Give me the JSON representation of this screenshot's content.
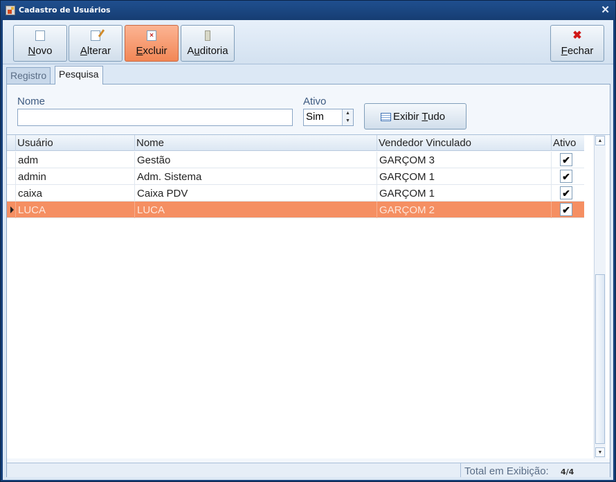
{
  "window": {
    "title": "Cadastro de Usuários"
  },
  "toolbar": {
    "novo": {
      "label": "Novo",
      "key": "N",
      "rest": "ovo"
    },
    "alterar": {
      "label": "Alterar",
      "key": "A",
      "rest": "lterar"
    },
    "excluir": {
      "label": "Excluir",
      "key": "E",
      "rest": "xcluir"
    },
    "auditoria": {
      "label": "Auditoria",
      "key": "u",
      "pre": "A",
      "rest": "ditoria"
    },
    "fechar": {
      "label": "Fechar",
      "key": "F",
      "rest": "echar"
    }
  },
  "tabs": [
    {
      "label": "Registro",
      "selected": false
    },
    {
      "label": "Pesquisa",
      "selected": true
    }
  ],
  "filters": {
    "nome_label": "Nome",
    "nome_value": "",
    "ativo_label": "Ativo",
    "ativo_value": "Sim",
    "exibir_pre": "Exibir ",
    "exibir_key": "T",
    "exibir_rest": "udo"
  },
  "grid": {
    "columns": [
      "Usuário",
      "Nome",
      "Vendedor Vinculado",
      "Ativo"
    ],
    "rows": [
      {
        "usuario": "adm",
        "nome": "Gestão",
        "vendedor": "GARÇOM 3",
        "ativo": true
      },
      {
        "usuario": "admin",
        "nome": "Adm. Sistema",
        "vendedor": "GARÇOM 1",
        "ativo": true
      },
      {
        "usuario": "caixa",
        "nome": "Caixa PDV",
        "vendedor": "GARÇOM 1",
        "ativo": true
      },
      {
        "usuario": "LUCA",
        "nome": "LUCA",
        "vendedor": "GARÇOM 2",
        "ativo": true
      }
    ]
  },
  "status": {
    "label": "Total em Exibição:",
    "value": "4/4"
  },
  "colors": {
    "selected_row": "#f58f62",
    "window_frame": "#16407a",
    "active_button": "#f28756"
  }
}
